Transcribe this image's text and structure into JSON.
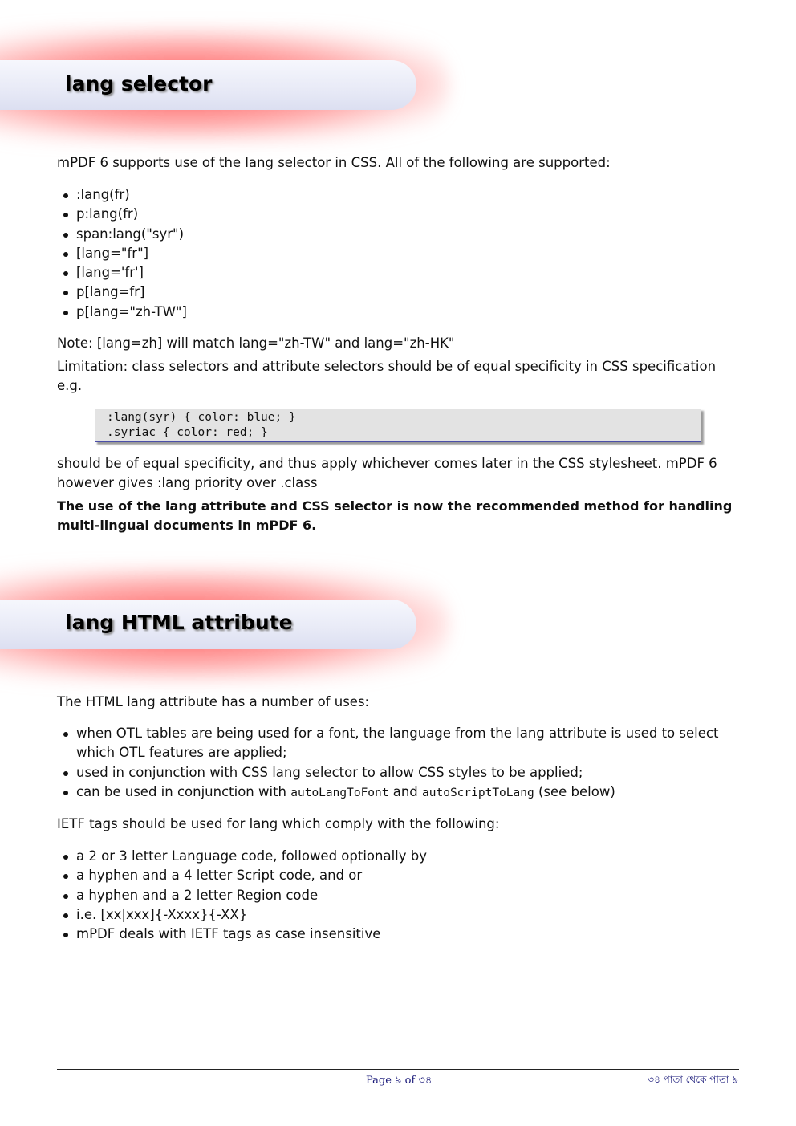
{
  "section1": {
    "heading": "lang selector",
    "intro": "mPDF 6 supports use of the lang selector in CSS. All of the following are supported:",
    "selectors": [
      ":lang(fr)",
      "p:lang(fr)",
      "span:lang(\"syr\")",
      "[lang=\"fr\"]",
      "[lang='fr']",
      "p[lang=fr]",
      "p[lang=\"zh-TW\"]"
    ],
    "note": "Note: [lang=zh] will match lang=\"zh-TW\" and lang=\"zh-HK\"",
    "limitation": "Limitation: class selectors and attribute selectors should be of equal specificity in CSS specification e.g.",
    "code_lines": [
      ":lang(syr) { color: blue; }",
      ".syriac { color: red; }"
    ],
    "after_code": "should be of equal specificity, and thus apply whichever comes later in the CSS stylesheet. mPDF 6 however gives :lang priority over .class",
    "recommendation": "The use of the lang attribute and CSS selector is now the recommended method for handling multi-lingual documents in mPDF 6."
  },
  "section2": {
    "heading": "lang HTML attribute",
    "intro": "The HTML lang attribute has a number of uses:",
    "uses": {
      "item1": "when OTL tables are being used for a font, the language from the lang attribute is used to select which OTL features are applied;",
      "item2": "used in conjunction with CSS lang selector to allow CSS styles to be applied;",
      "item3_prefix": "can be used in conjunction with ",
      "item3_code1": "autoLangToFont",
      "item3_mid": " and ",
      "item3_code2": "autoScriptToLang",
      "item3_suffix": " (see below)"
    },
    "ietf_intro": "IETF tags should be used for lang which comply with the following:",
    "ietf_rules": [
      "a 2 or 3 letter Language code, followed optionally by",
      "a hyphen and a 4 letter Script code, and or",
      "a hyphen and a 2 letter Region code",
      "i.e. [xx|xxx]{-Xxxx}{-XX}",
      "mPDF deals with IETF tags as case insensitive"
    ]
  },
  "footer": {
    "center": "Page ৯ of ৩৪",
    "right": "৩৪ পাতা থেকে পাতা ৯"
  },
  "colors": {
    "banner_glow": "#ff4040",
    "banner_fill": "#e9ebf7",
    "code_bg": "#e3e3e3",
    "code_border": "#4b4ea8",
    "footer_text": "#1a1a7a"
  }
}
